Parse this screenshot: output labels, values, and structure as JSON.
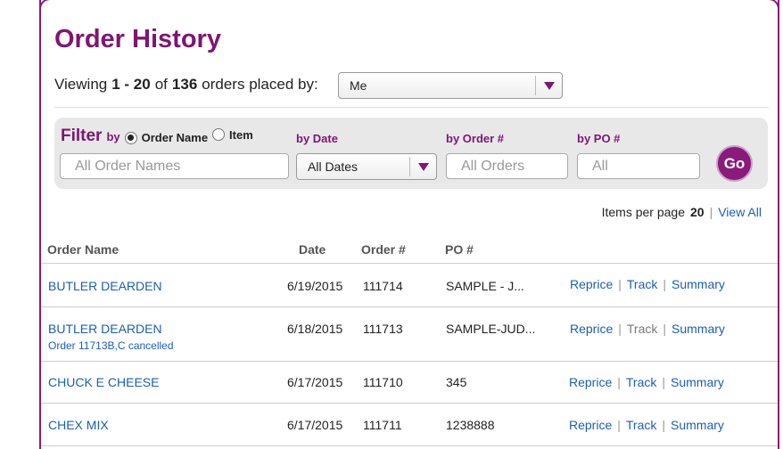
{
  "page": {
    "title": "Order History"
  },
  "viewing": {
    "prefix": "Viewing",
    "range": "1 - 20",
    "of": "of",
    "total": "136",
    "suffix": "orders placed by:",
    "selected": "Me"
  },
  "filter": {
    "label": "Filter",
    "by": "by",
    "radio_order_name": "Order Name",
    "radio_item": "Item",
    "by_date": "by Date",
    "by_order": "by Order #",
    "by_po": "by PO #",
    "order_names_placeholder": "All Order Names",
    "date_selected": "All Dates",
    "orders_placeholder": "All Orders",
    "po_placeholder": "All",
    "go_label": "Go"
  },
  "paging": {
    "items_per_page_label": "Items per page",
    "items_per_page": "20",
    "view_all": "View All"
  },
  "table": {
    "columns": [
      "Order Name",
      "Date",
      "Order #",
      "PO #"
    ],
    "actions": {
      "reprice": "Reprice",
      "track": "Track",
      "summary": "Summary"
    },
    "rows": [
      {
        "name": "BUTLER DEARDEN",
        "note": "",
        "date": "6/19/2015",
        "order": "111714",
        "po": "SAMPLE - J..."
      },
      {
        "name": "BUTLER DEARDEN",
        "note": "Order 11713B,C cancelled",
        "date": "6/18/2015",
        "order": "111713",
        "po": "SAMPLE-JUD..."
      },
      {
        "name": "CHUCK E CHEESE",
        "note": "",
        "date": "6/17/2015",
        "order": "111710",
        "po": "345"
      },
      {
        "name": "CHEX MIX",
        "note": "",
        "date": "6/17/2015",
        "order": "111711",
        "po": "1238888"
      }
    ]
  },
  "colors": {
    "brand": "#7e1672",
    "link": "#1a5fb4"
  }
}
